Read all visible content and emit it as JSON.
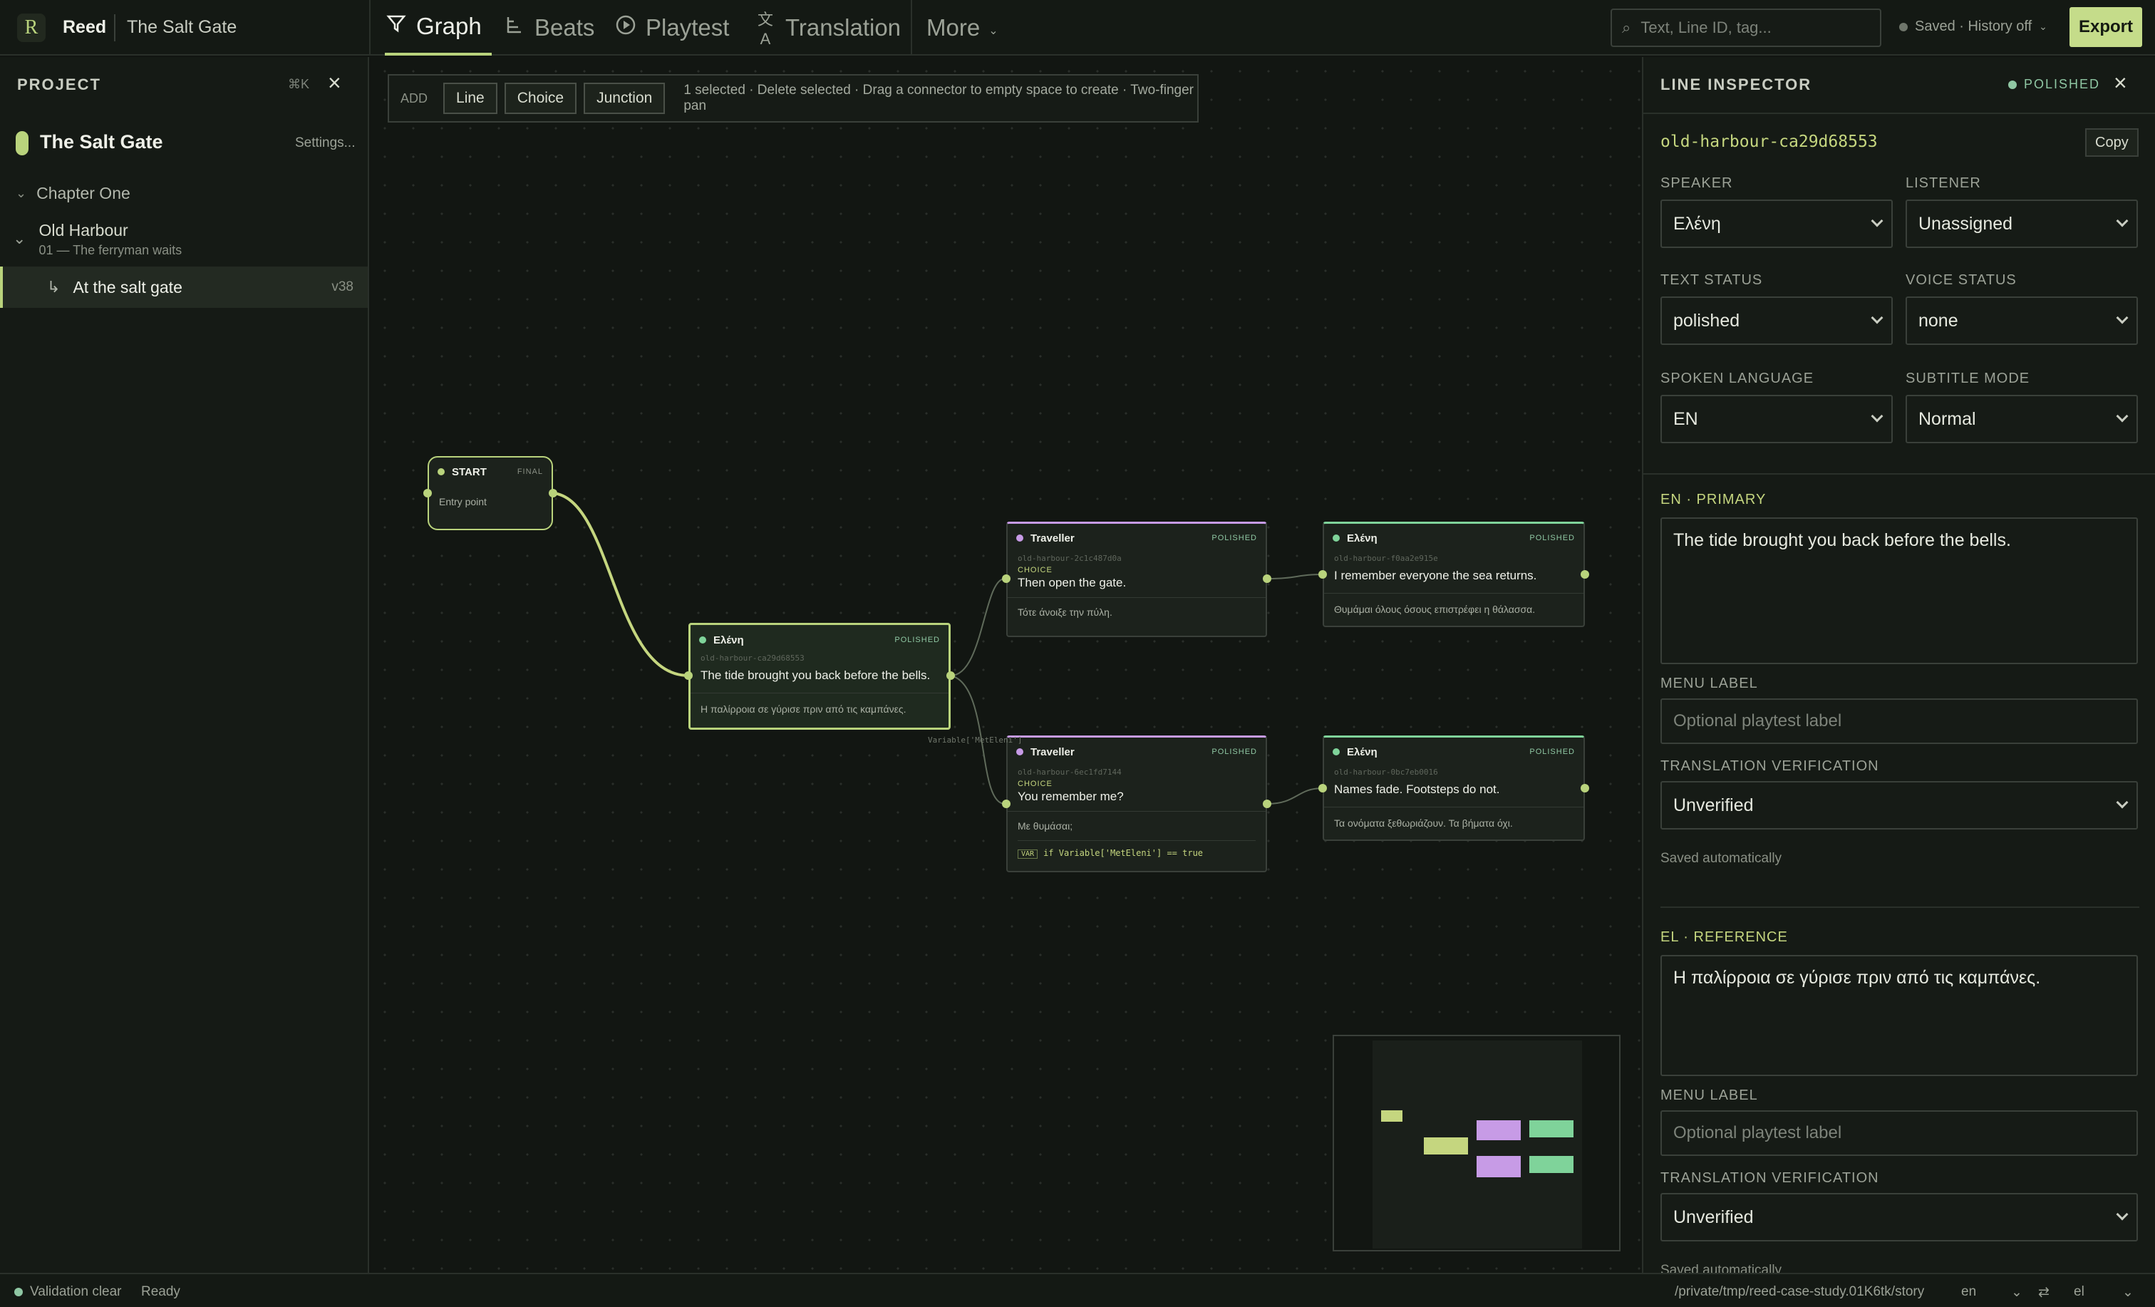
{
  "app": {
    "name": "Reed",
    "project_title": "The Salt Gate"
  },
  "tabs": [
    {
      "label": "Graph",
      "icon": "graph-icon"
    },
    {
      "label": "Beats",
      "icon": "beats-icon"
    },
    {
      "label": "Playtest",
      "icon": "play-icon"
    },
    {
      "label": "Translation",
      "icon": "translate-icon"
    },
    {
      "label": "More",
      "icon": "chevron-down-icon"
    }
  ],
  "search": {
    "placeholder": "Text, Line ID, tag..."
  },
  "save_status": "Saved · History off",
  "export_label": "Export",
  "sidebar": {
    "heading": "PROJECT",
    "shortcut": "⌘K",
    "project_name": "The Salt Gate",
    "settings_label": "Settings...",
    "chapter": "Chapter One",
    "scene": {
      "title": "Old Harbour",
      "subtitle": "01 — The ferryman waits"
    },
    "line": {
      "label": "At the salt gate",
      "version": "v38"
    }
  },
  "toolbar": {
    "add_label": "ADD",
    "buttons": [
      "Line",
      "Choice",
      "Junction"
    ],
    "hint": "1 selected · Delete selected · Drag a connector to empty space to create · Two-finger pan"
  },
  "nodes": {
    "start": {
      "title": "START",
      "status": "FINAL",
      "text": "Entry point"
    },
    "eleni_main": {
      "speaker": "Ελένη",
      "status": "POLISHED",
      "id": "old-harbour-ca29d68553",
      "text": "The tide brought you back before the bells.",
      "translation": "Η παλίρροια σε γύρισε πριν από τις καμπάνες."
    },
    "traveller_1": {
      "speaker": "Traveller",
      "status": "POLISHED",
      "id": "old-harbour-2c1c487d0a",
      "tag": "CHOICE",
      "text": "Then open the gate.",
      "translation": "Τότε άνοιξε την πύλη."
    },
    "eleni_2": {
      "speaker": "Ελένη",
      "status": "POLISHED",
      "id": "old-harbour-f0aa2e915e",
      "text": "I remember everyone the sea returns.",
      "translation": "Θυμάμαι όλους όσους επιστρέφει η θάλασσα."
    },
    "traveller_2": {
      "speaker": "Traveller",
      "status": "POLISHED",
      "id": "old-harbour-6ec1fd7144",
      "tag": "CHOICE",
      "text": "You remember me?",
      "translation": "Με θυμάσαι;",
      "condition_tag": "VAR",
      "condition": "if Variable['MetEleni'] == true"
    },
    "eleni_3": {
      "speaker": "Ελένη",
      "status": "POLISHED",
      "id": "old-harbour-0bc7eb0016",
      "text": "Names fade. Footsteps do not.",
      "translation": "Τα ονόματα ξεθωριάζουν. Τα βήματα όχι."
    }
  },
  "edge_label": "Variable['MetEleni']",
  "inspector": {
    "heading": "LINE INSPECTOR",
    "status": "POLISHED",
    "line_id": "old-harbour-ca29d68553",
    "copy_label": "Copy",
    "speaker_label": "SPEAKER",
    "speaker": "Ελένη",
    "listener_label": "LISTENER",
    "listener": "Unassigned",
    "text_status_label": "TEXT STATUS",
    "text_status": "polished",
    "voice_status_label": "VOICE STATUS",
    "voice_status": "none",
    "spoken_language_label": "SPOKEN LANGUAGE",
    "spoken_language": "EN",
    "subtitle_mode_label": "SUBTITLE MODE",
    "subtitle_mode": "Normal",
    "primary": {
      "heading": "EN · PRIMARY",
      "text": "The tide brought you back before the bells.",
      "menu_label": "MENU LABEL",
      "menu_placeholder": "Optional playtest label",
      "verification_label": "TRANSLATION VERIFICATION",
      "verification": "Unverified",
      "note": "Saved automatically"
    },
    "reference": {
      "heading": "EL · REFERENCE",
      "text": "Η παλίρροια σε γύρισε πριν από τις καμπάνες.",
      "menu_label": "MENU LABEL",
      "menu_placeholder": "Optional playtest label",
      "verification_label": "TRANSLATION VERIFICATION",
      "verification": "Unverified",
      "note": "Saved automatically"
    }
  },
  "statusbar": {
    "validation": "Validation clear",
    "ready": "Ready",
    "path": "/private/tmp/reed-case-study.01K6tk/story",
    "lang_from": "en",
    "lang_to": "el"
  },
  "colors": {
    "accent": "#b9d37c",
    "polished": "#8fc7a3",
    "traveller": "#c79be6",
    "eleni": "#7fd39a"
  }
}
